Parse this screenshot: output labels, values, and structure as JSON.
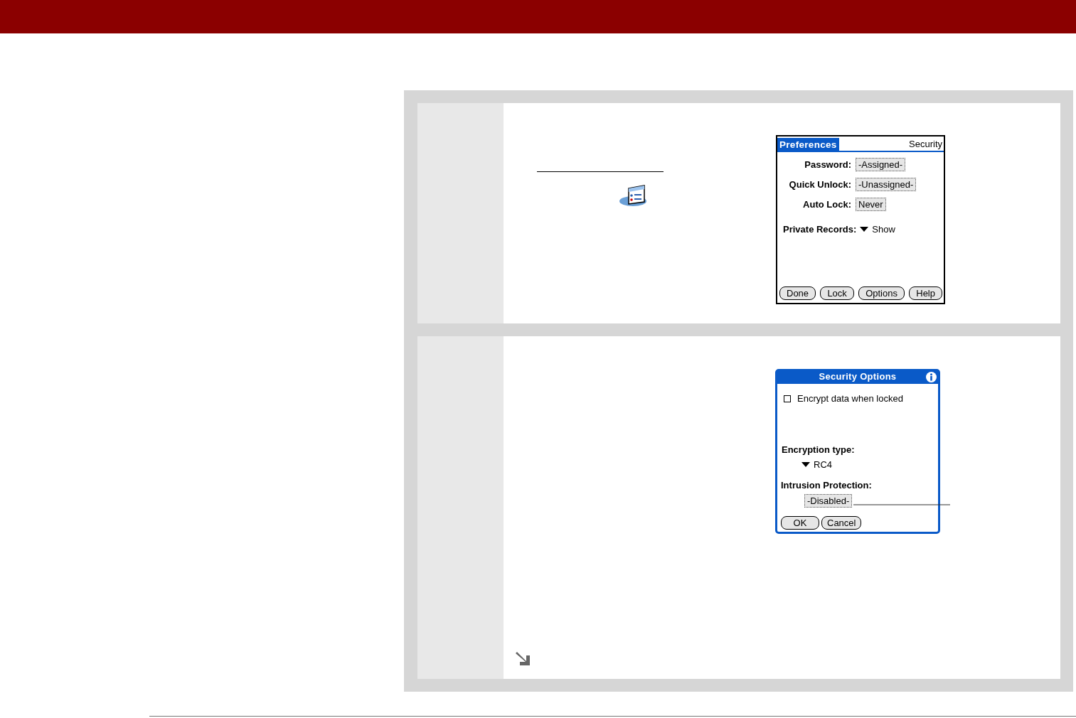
{
  "preferences_screen": {
    "title": "Preferences",
    "section": "Security",
    "fields": [
      {
        "label": "Password:",
        "value": "-Assigned-"
      },
      {
        "label": "Quick Unlock:",
        "value": "-Unassigned-"
      },
      {
        "label": "Auto Lock:",
        "value": "Never"
      }
    ],
    "private_records": {
      "label": "Private Records:",
      "value": "Show"
    },
    "buttons": [
      "Done",
      "Lock",
      "Options",
      "Help"
    ]
  },
  "security_options_dialog": {
    "title": "Security Options",
    "checkbox": {
      "label": "Encrypt data when locked",
      "checked": false
    },
    "encryption_type": {
      "label": "Encryption type:",
      "value": "RC4"
    },
    "intrusion_protection": {
      "label": "Intrusion Protection:",
      "value": "-Disabled-"
    },
    "buttons": [
      "OK",
      "Cancel"
    ]
  }
}
